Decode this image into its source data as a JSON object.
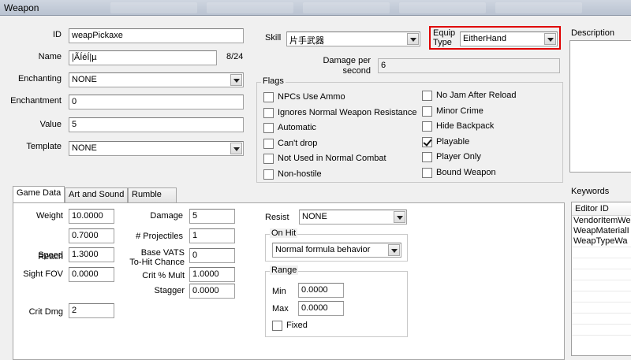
{
  "window": {
    "title": "Weapon"
  },
  "fields": {
    "id_label": "ID",
    "id_value": "weapPickaxe",
    "name_label": "Name",
    "name_value": "|ÃÍéÍ|µ",
    "name_counter": "8/24",
    "enchanting_label": "Enchanting",
    "enchanting_value": "NONE",
    "enchantment_label": "Enchantment",
    "enchantment_value": "0",
    "value_label": "Value",
    "value_value": "5",
    "template_label": "Template",
    "template_value": "NONE",
    "skill_label": "Skill",
    "skill_value": "片手武器",
    "equip_type_label_1": "Equip",
    "equip_type_label_2": "Type",
    "equip_type_value": "EitherHand",
    "dps_label_1": "Damage per",
    "dps_label_2": "second",
    "dps_value": "6",
    "description_label": "Description",
    "keywords_label": "Keywords"
  },
  "flags": {
    "title": "Flags",
    "left": [
      {
        "label": "NPCs Use Ammo",
        "checked": false
      },
      {
        "label": "Ignores Normal Weapon Resistance",
        "checked": false
      },
      {
        "label": "Automatic",
        "checked": false
      },
      {
        "label": "Can't drop",
        "checked": false
      },
      {
        "label": "Not Used in Normal Combat",
        "checked": false
      },
      {
        "label": "Non-hostile",
        "checked": false
      }
    ],
    "right": [
      {
        "label": "No Jam After Reload",
        "checked": false
      },
      {
        "label": "Minor Crime",
        "checked": false
      },
      {
        "label": "Hide Backpack",
        "checked": false
      },
      {
        "label": "Playable",
        "checked": true
      },
      {
        "label": "Player Only",
        "checked": false
      },
      {
        "label": "Bound Weapon",
        "checked": false
      }
    ]
  },
  "tabs": [
    {
      "label": "Game Data",
      "active": true
    },
    {
      "label": "Art and Sound",
      "active": false
    },
    {
      "label": "Rumble",
      "active": false
    }
  ],
  "game_data": {
    "weight_label": "Weight",
    "weight_value": "10.0000",
    "reach_label": "Reach",
    "reach_value": "0.7000",
    "speed_label": "Speed",
    "speed_value": "1.3000",
    "sight_fov_label": "Sight FOV",
    "sight_fov_value": "0.0000",
    "crit_dmg_label": "Crit Dmg",
    "crit_dmg_value": "2",
    "damage_label": "Damage",
    "damage_value": "5",
    "projectiles_label": "# Projectiles",
    "projectiles_value": "1",
    "vats_label_1": "Base VATS",
    "vats_label_2": "To-Hit Chance",
    "vats_value": "0",
    "crit_mult_label": "Crit % Mult",
    "crit_mult_value": "1.0000",
    "stagger_label": "Stagger",
    "stagger_value": "0.0000",
    "resist_label": "Resist",
    "resist_value": "NONE",
    "on_hit_title": "On Hit",
    "on_hit_value": "Normal formula behavior",
    "range_title": "Range",
    "range_min_label": "Min",
    "range_min_value": "0.0000",
    "range_max_label": "Max",
    "range_max_value": "0.0000",
    "fixed_label": "Fixed",
    "fixed_checked": false
  },
  "keywords": {
    "column_header": "Editor ID",
    "items": [
      "VendorItemWe",
      "WeapMaterialI",
      "WeapTypeWa"
    ]
  },
  "colors": {
    "highlight_box": "#e00000",
    "panel_bg": "#f0f0f0"
  }
}
